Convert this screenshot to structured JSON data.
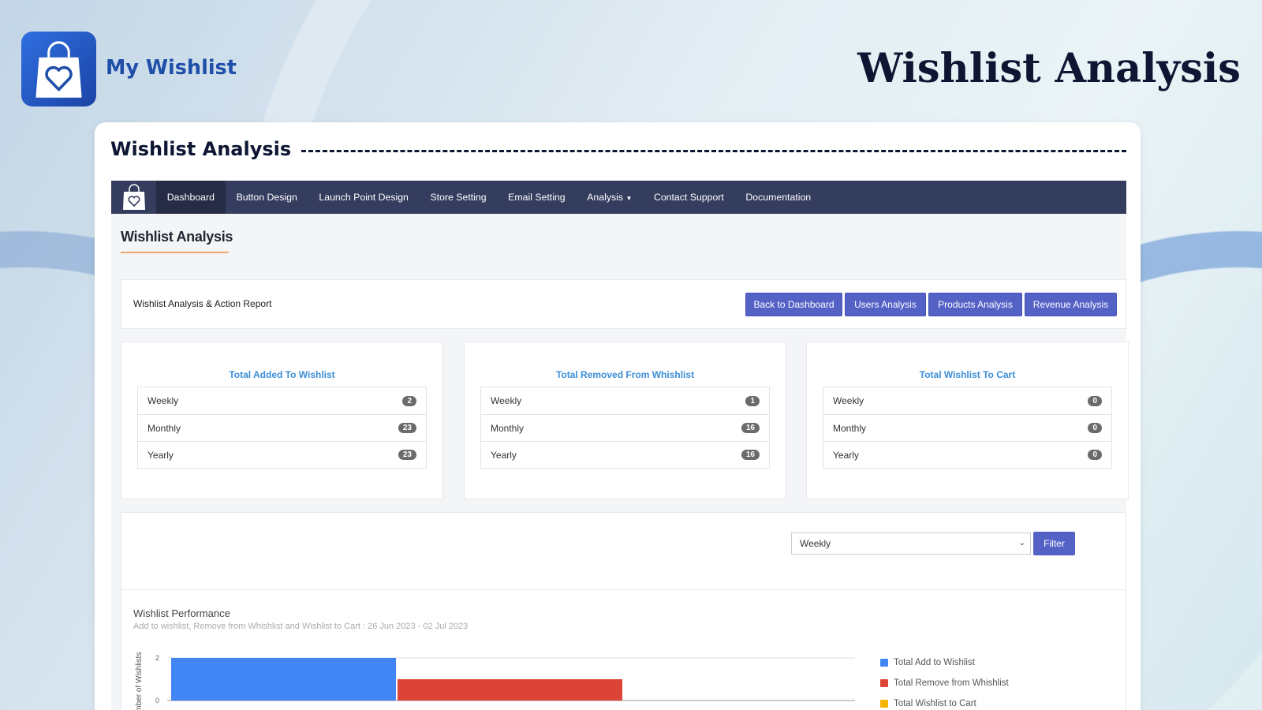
{
  "brand": {
    "name": "My Wishlist",
    "icon": "heart-bag-icon"
  },
  "hero_title": "Wishlist Analysis",
  "card_title": "Wishlist Analysis",
  "nav": {
    "items": [
      "Dashboard",
      "Button Design",
      "Launch Point Design",
      "Store Setting",
      "Email Setting",
      "Analysis",
      "Contact Support",
      "Documentation"
    ],
    "active": "Dashboard"
  },
  "section_title": "Wishlist Analysis",
  "actions": {
    "label": "Wishlist Analysis & Action Report",
    "buttons": [
      "Back to Dashboard",
      "Users Analysis",
      "Products Analysis",
      "Revenue Analysis"
    ]
  },
  "stats": [
    {
      "title": "Total Added To Wishlist",
      "rows": [
        {
          "label": "Weekly",
          "value": "2"
        },
        {
          "label": "Monthly",
          "value": "23"
        },
        {
          "label": "Yearly",
          "value": "23"
        }
      ]
    },
    {
      "title": "Total Removed From Whishlist",
      "rows": [
        {
          "label": "Weekly",
          "value": "1"
        },
        {
          "label": "Monthly",
          "value": "16"
        },
        {
          "label": "Yearly",
          "value": "16"
        }
      ]
    },
    {
      "title": "Total Wishlist To Cart",
      "rows": [
        {
          "label": "Weekly",
          "value": "0"
        },
        {
          "label": "Monthly",
          "value": "0"
        },
        {
          "label": "Yearly",
          "value": "0"
        }
      ]
    }
  ],
  "filter": {
    "selected": "Weekly",
    "button": "Filter"
  },
  "colors": {
    "accent": "#5462c6",
    "nav": "#353d5e",
    "add": "#4285f4",
    "remove": "#db4437",
    "cart": "#f4b400"
  },
  "chart_data": {
    "type": "bar",
    "title": "Wishlist Performance",
    "subtitle": "Add to wishlist, Remove from Whishlist and Wishlist to Cart : 26 Jun 2023 - 02 Jul 2023",
    "ylabel": "Number of Wishlists",
    "ylim": [
      0,
      2
    ],
    "yticks": [
      "0",
      "2"
    ],
    "legend": "right",
    "series": [
      {
        "name": "Total Add to Wishlist",
        "value": 2,
        "color": "#4285f4"
      },
      {
        "name": "Total Remove from Whishlist",
        "value": 1,
        "color": "#db4437"
      },
      {
        "name": "Total Wishlist to Cart",
        "value": 0,
        "color": "#f4b400"
      }
    ]
  }
}
